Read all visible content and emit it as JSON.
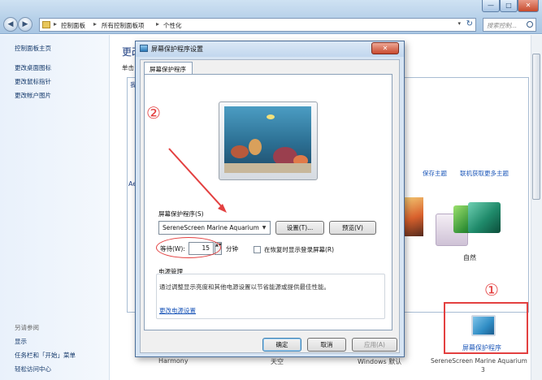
{
  "window": {
    "min": "—",
    "max": "□",
    "close": "✕",
    "back": "◀",
    "forward": "▶"
  },
  "address": {
    "crumbs": [
      "控制面板",
      "所有控制面板项",
      "个性化"
    ],
    "sep": "▸",
    "dropdown": "▾",
    "refresh": "↻"
  },
  "search": {
    "placeholder": "搜索控制..."
  },
  "left_pane": {
    "links": [
      "控制面板主页",
      "更改桌面图标",
      "更改鼠标指针",
      "更改帐户图片"
    ],
    "see_also": "另请参阅",
    "see_also_links": [
      "显示",
      "任务栏和「开始」菜单",
      "轻松访问中心"
    ]
  },
  "content": {
    "heading": "更改",
    "sub_heading": "单击",
    "tab_fragment": "我",
    "save_theme": "保存主题",
    "online_theme": "联机获取更多主题",
    "aero_label": "Ae",
    "nature": "自然",
    "harmony": "Harmony",
    "sky": "天空",
    "windows_default": "Windows 默认",
    "screensaver_tile": "屏幕保护程序",
    "screensaver_name": "SereneScreen Marine Aquarium",
    "screensaver_name_2": "3"
  },
  "annotations": {
    "one": "①",
    "two": "②",
    "color": "#e34040"
  },
  "dialog": {
    "title": "屏幕保护程序设置",
    "close": "✕",
    "tab": "屏幕保护程序",
    "group_label": "屏幕保护程序(S)",
    "selected_saver": "SereneScreen Marine Aquarium",
    "select_arrow": "▼",
    "settings_button": "设置(T)...",
    "preview_button": "预览(V)",
    "wait_label": "等待(W):",
    "wait_value": "15",
    "spin": "▲▼",
    "minutes": "分钟",
    "resume_label": "在恢复时显示登录屏幕(R)",
    "power_label": "电源管理",
    "power_desc": "通过调整显示亮度和其他电源设置以节省能源或提供最佳性能。",
    "power_link": "更改电源设置",
    "ok": "确定",
    "cancel": "取消",
    "apply": "应用(A)"
  }
}
